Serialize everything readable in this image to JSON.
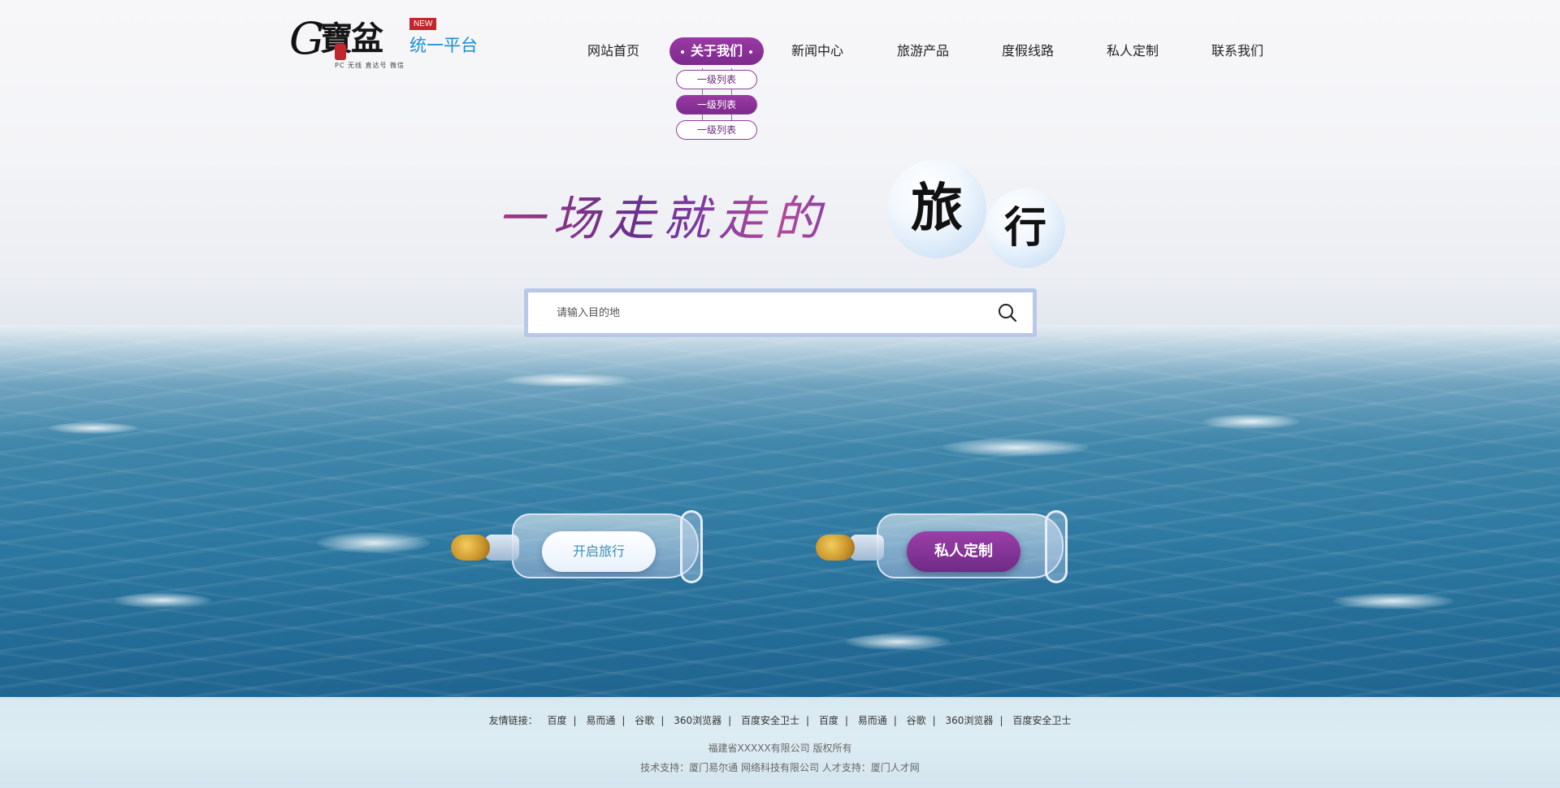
{
  "logo": {
    "letter": "G",
    "brand": "寶盆",
    "badge": "NEW",
    "platform": "统一平台",
    "tagline": "PC 无线 直达号 微信"
  },
  "nav": {
    "items": [
      {
        "label": "网站首页"
      },
      {
        "label": "关于我们",
        "active": true
      },
      {
        "label": "新闻中心"
      },
      {
        "label": "旅游产品"
      },
      {
        "label": "度假线路"
      },
      {
        "label": "私人定制"
      },
      {
        "label": "联系我们"
      }
    ],
    "submenu": [
      {
        "label": "一级列表"
      },
      {
        "label": "一级列表",
        "active": true
      },
      {
        "label": "一级列表"
      }
    ]
  },
  "hero": {
    "title": "一场走就走的",
    "bubble1": "旅",
    "bubble2": "行"
  },
  "search": {
    "placeholder": "请输入目的地",
    "icon": "search-icon"
  },
  "actions": {
    "start": "开启旅行",
    "custom": "私人定制"
  },
  "footer": {
    "links_label": "友情链接：",
    "links": [
      "百度",
      "易而通",
      "谷歌",
      "360浏览器",
      "百度安全卫士",
      "百度",
      "易而通",
      "谷歌",
      "360浏览器",
      "百度安全卫士"
    ],
    "copyright": "福建省XXXXX有限公司 版权所有",
    "support": "技术支持：厦门易尔通 网络科技有限公司 人才支持：厦门人才网"
  },
  "colors": {
    "accent": "#7c2a8c",
    "logo_blue": "#1b8fd1",
    "badge_red": "#c1272d",
    "search_border": "#b8c8e8"
  }
}
